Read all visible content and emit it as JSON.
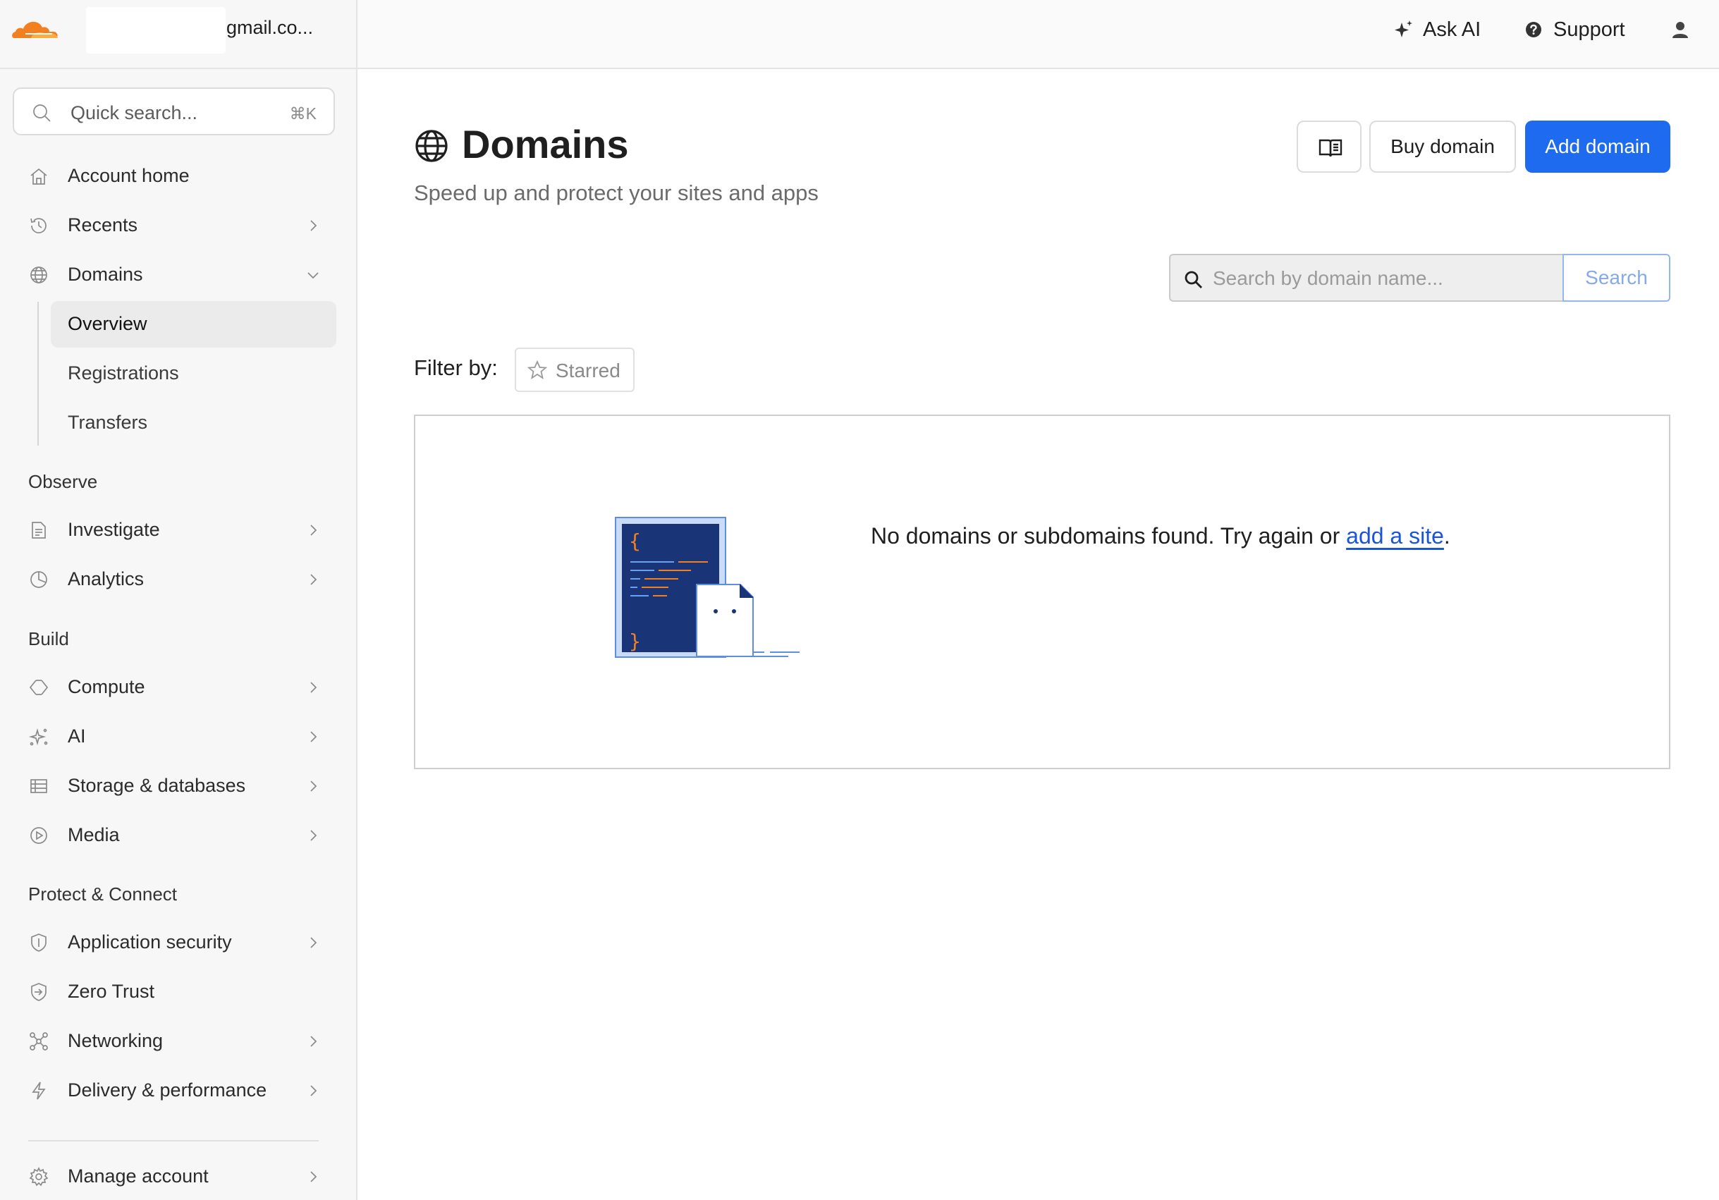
{
  "account": {
    "email": "gmail.co..."
  },
  "quick_search": {
    "placeholder": "Quick search...",
    "shortcut": "⌘K"
  },
  "sidebar": {
    "items": [
      {
        "label": "Account home",
        "icon": "home-icon"
      },
      {
        "label": "Recents",
        "icon": "history-icon"
      },
      {
        "label": "Domains",
        "icon": "globe-icon",
        "expanded": true,
        "children": [
          "Overview",
          "Registrations",
          "Transfers"
        ],
        "active_child": "Overview"
      }
    ],
    "sections": [
      {
        "title": "Observe",
        "items": [
          {
            "label": "Investigate",
            "icon": "document-search-icon"
          },
          {
            "label": "Analytics",
            "icon": "pie-chart-icon"
          }
        ]
      },
      {
        "title": "Build",
        "items": [
          {
            "label": "Compute",
            "icon": "compute-icon"
          },
          {
            "label": "AI",
            "icon": "sparkle-icon"
          },
          {
            "label": "Storage & databases",
            "icon": "storage-icon"
          },
          {
            "label": "Media",
            "icon": "play-icon"
          }
        ]
      },
      {
        "title": "Protect & Connect",
        "items": [
          {
            "label": "Application security",
            "icon": "shield-icon"
          },
          {
            "label": "Zero Trust",
            "icon": "zero-trust-icon"
          },
          {
            "label": "Networking",
            "icon": "network-icon"
          },
          {
            "label": "Delivery & performance",
            "icon": "lightning-icon"
          }
        ]
      }
    ],
    "footer": {
      "label": "Manage account",
      "icon": "gear-icon"
    }
  },
  "topbar": {
    "ask_ai": "Ask AI",
    "support": "Support"
  },
  "page": {
    "title": "Domains",
    "subtitle": "Speed up and protect your sites and apps",
    "buy_domain": "Buy domain",
    "add_domain": "Add domain",
    "search_placeholder": "Search by domain name...",
    "search_button": "Search",
    "filter_label": "Filter by:",
    "filter_starred": "Starred",
    "empty_message": "No domains or subdomains found. Try again or ",
    "empty_link": "add a site",
    "empty_period": "."
  },
  "colors": {
    "accent": "#1f6bf0",
    "brand_orange": "#f38020",
    "illustration_navy": "#1a3478"
  }
}
